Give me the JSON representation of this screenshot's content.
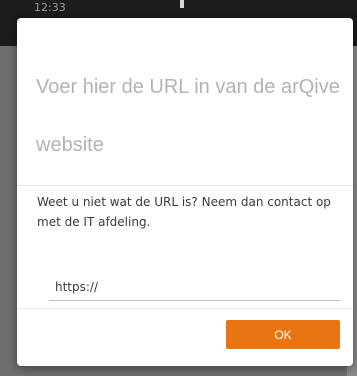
{
  "status_bar": {
    "time": "12:33"
  },
  "dialog": {
    "title": "Voer hier de URL in van de arQive website",
    "help_text": "Weet u niet wat de URL is? Neem dan contact op met de IT afdeling.",
    "url_input": {
      "value": "https://",
      "placeholder": ""
    },
    "ok_label": "OK"
  },
  "colors": {
    "accent": "#e87511",
    "title_text": "#b3b3b3",
    "body_text": "#3a3a3a",
    "overlay": "#6f6f6f"
  }
}
